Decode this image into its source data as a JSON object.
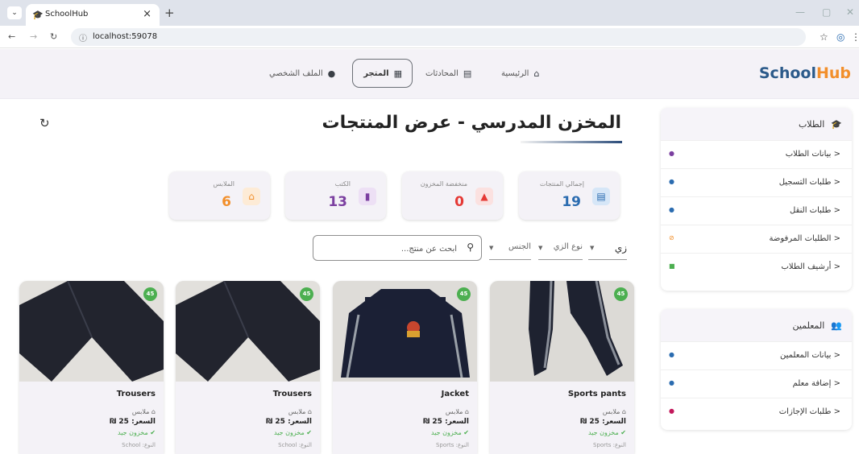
{
  "browser": {
    "tab_title": "SchoolHub",
    "url": "localhost:59078"
  },
  "navbar": {
    "logo_part1": "School",
    "logo_part2": "Hub",
    "items": [
      {
        "label": "الرئيسية",
        "icon": "home-icon"
      },
      {
        "label": "المحادثات",
        "icon": "chat-icon"
      },
      {
        "label": "المتجر",
        "icon": "store-icon",
        "active": true
      },
      {
        "label": "الملف الشخصي",
        "icon": "person-icon"
      }
    ]
  },
  "sidebar": {
    "students": {
      "title": "الطلاب",
      "items": [
        "بيانات الطلاب",
        "طلبات التسجيل",
        "طلبات النقل",
        "الطلبات المرفوضة",
        "أرشيف الطلاب"
      ]
    },
    "teachers": {
      "title": "المعلمين",
      "items": [
        "بيانات المعلمين",
        "إضافة معلم",
        "طلبات الإجازات"
      ]
    }
  },
  "page": {
    "title": "المخزن المدرسي - عرض المنتجات"
  },
  "stats": [
    {
      "label": "إجمالي المنتجات",
      "value": "19",
      "color": "#2b6cb0"
    },
    {
      "label": "منخفضة المخزون",
      "value": "0",
      "color": "#e53935"
    },
    {
      "label": "الكتب",
      "value": "13",
      "color": "#7b3fa0"
    },
    {
      "label": "الملابس",
      "value": "6",
      "color": "#f28f2b"
    }
  ],
  "filters": {
    "uniform": "زي",
    "uniform_type": "نوع الزي",
    "gender": "الجنس",
    "search_placeholder": "ابحث عن منتج..."
  },
  "products": [
    {
      "name": "Sports pants",
      "badge": "45",
      "category": "ملابس",
      "price": "السعر: 25 ₪",
      "stock": "مخزون جيد",
      "type": "النوع: Sports"
    },
    {
      "name": "Jacket",
      "badge": "45",
      "category": "ملابس",
      "price": "السعر: 25 ₪",
      "stock": "مخزون جيد",
      "type": "النوع: Sports"
    },
    {
      "name": "Trousers",
      "badge": "45",
      "category": "ملابس",
      "price": "السعر: 25 ₪",
      "stock": "مخزون جيد",
      "type": "النوع: School"
    },
    {
      "name": "Trousers",
      "badge": "45",
      "category": "ملابس",
      "price": "السعر: 25 ₪",
      "stock": "مخزون جيد",
      "type": "النوع: School"
    }
  ]
}
